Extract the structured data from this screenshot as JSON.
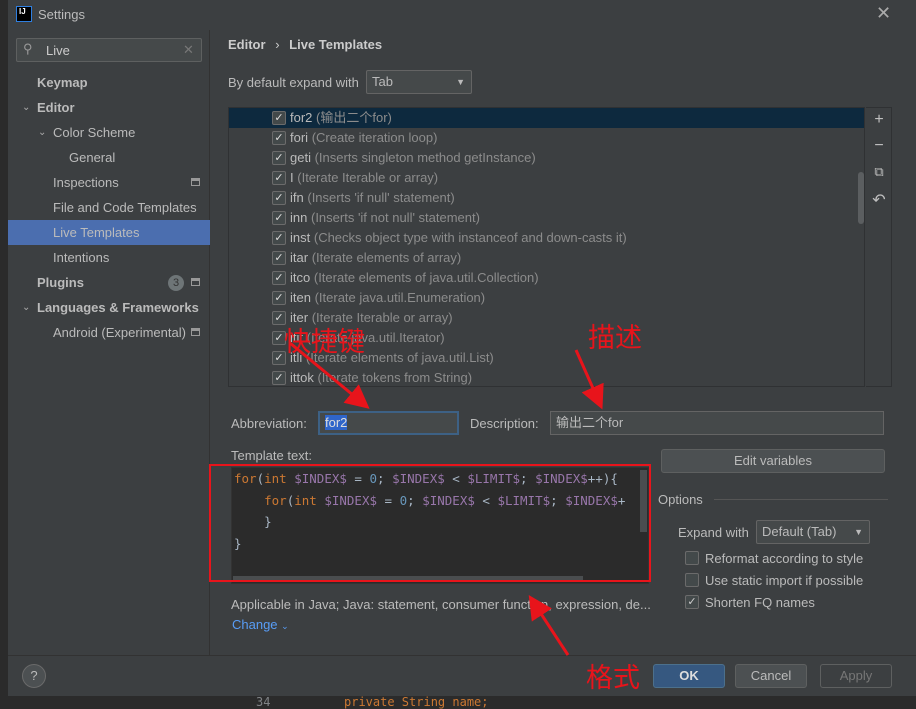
{
  "window": {
    "title": "Settings",
    "close_icon": "close-icon"
  },
  "search": {
    "value": "Live"
  },
  "sidebar": {
    "items": [
      {
        "label": "Keymap"
      },
      {
        "label": "Editor"
      },
      {
        "label": "Color Scheme"
      },
      {
        "label": "General"
      },
      {
        "label": "Inspections"
      },
      {
        "label": "File and Code Templates"
      },
      {
        "label": "Live Templates"
      },
      {
        "label": "Intentions"
      },
      {
        "label": "Plugins",
        "badge": "3"
      },
      {
        "label": "Languages & Frameworks"
      },
      {
        "label": "Android (Experimental)"
      }
    ]
  },
  "breadcrumb": {
    "parent": "Editor",
    "sep": "›",
    "current": "Live Templates"
  },
  "expand": {
    "label": "By default expand with",
    "value": "Tab"
  },
  "templates": [
    {
      "abbr": "for2",
      "desc": "(输出二个for)"
    },
    {
      "abbr": "fori",
      "desc": "(Create iteration loop)"
    },
    {
      "abbr": "geti",
      "desc": "(Inserts singleton method getInstance)"
    },
    {
      "abbr": "I",
      "desc": "(Iterate Iterable or array)"
    },
    {
      "abbr": "ifn",
      "desc": "(Inserts 'if null' statement)"
    },
    {
      "abbr": "inn",
      "desc": "(Inserts 'if not null' statement)"
    },
    {
      "abbr": "inst",
      "desc": "(Checks object type with instanceof and down-casts it)"
    },
    {
      "abbr": "itar",
      "desc": "(Iterate elements of array)"
    },
    {
      "abbr": "itco",
      "desc": "(Iterate elements of java.util.Collection)"
    },
    {
      "abbr": "iten",
      "desc": "(Iterate java.util.Enumeration)"
    },
    {
      "abbr": "iter",
      "desc": "(Iterate Iterable or array)"
    },
    {
      "abbr": "itit",
      "desc": "(Iterate java.util.Iterator)"
    },
    {
      "abbr": "itli",
      "desc": "(Iterate elements of java.util.List)"
    },
    {
      "abbr": "ittok",
      "desc": "(Iterate tokens from String)"
    }
  ],
  "toolbar": {
    "add": "+",
    "remove": "−",
    "copy": "⧉",
    "restore": "↶"
  },
  "abbreviation": {
    "label": "Abbreviation:",
    "value": "for2"
  },
  "description": {
    "label": "Description:",
    "value": "输出二个for"
  },
  "template_text": {
    "label": "Template text:",
    "lines": [
      [
        "for",
        "(",
        "int",
        " $INDEX$",
        " = ",
        "0",
        "; ",
        "$INDEX$",
        " < ",
        "$LIMIT$",
        "; ",
        "$INDEX$",
        "++){"
      ],
      [
        "    for",
        "(",
        "int",
        " $INDEX$",
        " = ",
        "0",
        "; ",
        "$INDEX$",
        " < ",
        "$LIMIT$",
        "; ",
        "$INDEX$",
        "+"
      ],
      [
        "    }"
      ],
      [
        "}"
      ]
    ]
  },
  "edit_variables": "Edit variables",
  "options": {
    "title": "Options",
    "expand_label": "Expand with",
    "expand_value": "Default (Tab)",
    "checks": [
      {
        "label": "Reformat according to style",
        "checked": false
      },
      {
        "label": "Use static import if possible",
        "checked": false
      },
      {
        "label": "Shorten FQ names",
        "checked": true
      }
    ]
  },
  "applicable": "Applicable in Java; Java: statement, consumer function, expression, de...",
  "change": "Change",
  "buttons": {
    "help": "?",
    "ok": "OK",
    "cancel": "Cancel",
    "apply": "Apply"
  },
  "background_code": {
    "line_no": "34",
    "text": "private String name;"
  },
  "annotations": {
    "shortcut": "快捷键",
    "description": "描述",
    "format": "格式",
    "color": "#e8141b"
  },
  "colors": {
    "selection": "#4b6eaf",
    "row_selected": "#0d293e",
    "ok": "#365880"
  }
}
